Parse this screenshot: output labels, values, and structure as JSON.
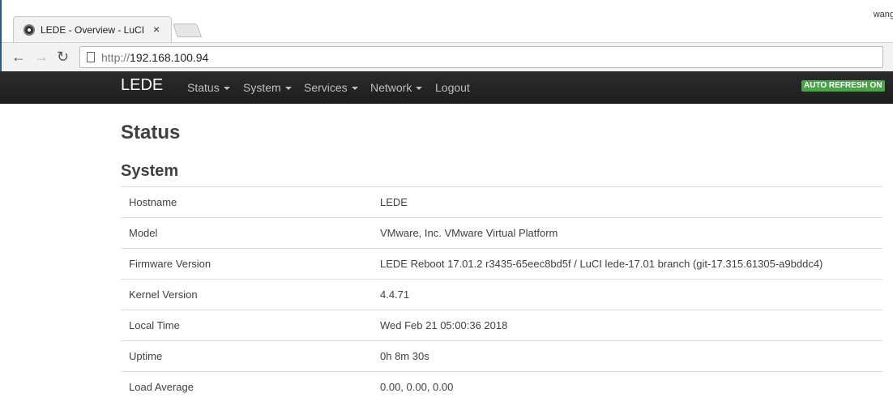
{
  "browser": {
    "tab_title": "LEDE - Overview - LuCI",
    "tab_close": "×",
    "user": "wang",
    "url_scheme": "http://",
    "url_host": "192.168.100.94"
  },
  "navbar": {
    "brand": "LEDE",
    "items": [
      "Status",
      "System",
      "Services",
      "Network",
      "Logout"
    ],
    "auto_refresh": "AUTO REFRESH ON",
    "auto_refresh_color": "#46a546"
  },
  "page": {
    "title": "Status",
    "section": "System",
    "rows": [
      {
        "key": "Hostname",
        "value": "LEDE"
      },
      {
        "key": "Model",
        "value": "VMware, Inc. VMware Virtual Platform"
      },
      {
        "key": "Firmware Version",
        "value": "LEDE Reboot 17.01.2 r3435-65eec8bd5f / LuCI lede-17.01 branch (git-17.315.61305-a9bddc4)"
      },
      {
        "key": "Kernel Version",
        "value": "4.4.71"
      },
      {
        "key": "Local Time",
        "value": "Wed Feb 21 05:00:36 2018"
      },
      {
        "key": "Uptime",
        "value": "0h 8m 30s"
      },
      {
        "key": "Load Average",
        "value": "0.00, 0.00, 0.00"
      }
    ]
  }
}
